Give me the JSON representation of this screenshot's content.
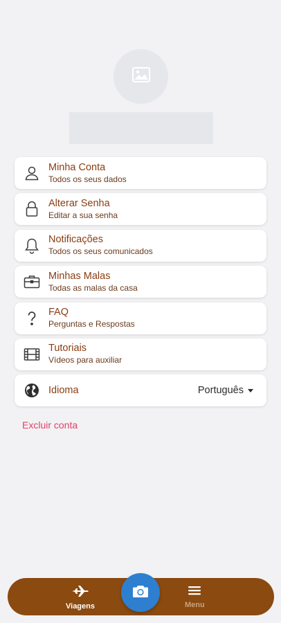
{
  "profile": {
    "avatar_icon": "image-placeholder-icon"
  },
  "menu": {
    "items": [
      {
        "title": "Minha Conta",
        "subtitle": "Todos os seus dados",
        "icon": "user-icon"
      },
      {
        "title": "Alterar Senha",
        "subtitle": "Editar a sua senha",
        "icon": "lock-icon"
      },
      {
        "title": "Notificações",
        "subtitle": "Todos os seus comunicados",
        "icon": "bell-icon"
      },
      {
        "title": "Minhas Malas",
        "subtitle": "Todas as malas da casa",
        "icon": "suitcase-icon"
      },
      {
        "title": "FAQ",
        "subtitle": "Perguntas e Respostas",
        "icon": "question-icon"
      },
      {
        "title": "Tutoriais",
        "subtitle": "Vídeos para auxiliar",
        "icon": "film-icon"
      }
    ],
    "language": {
      "title": "Idioma",
      "value": "Português",
      "icon": "globe-icon"
    }
  },
  "delete_account_label": "Excluir conta",
  "bottom_nav": {
    "trips_label": "Viagens",
    "menu_label": "Menu",
    "camera_icon": "camera-icon"
  },
  "colors": {
    "accent": "#8a3d12",
    "nav_bg": "#8a4a10",
    "camera": "#2e7fd0",
    "danger": "#e0416a"
  }
}
